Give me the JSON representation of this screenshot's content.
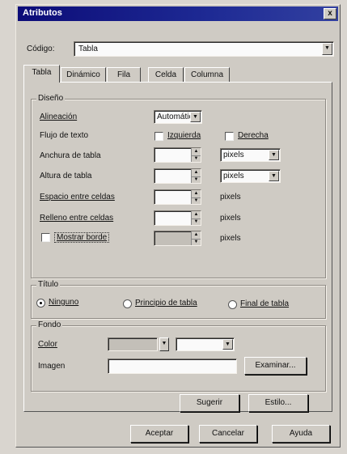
{
  "window": {
    "title": "Atributos",
    "close": "x"
  },
  "codigo": {
    "label": "Código:",
    "value": "Tabla"
  },
  "tabs": [
    {
      "label": "Tabla"
    },
    {
      "label": "Dinámico"
    },
    {
      "label": "Fila"
    },
    {
      "label": "Celda"
    },
    {
      "label": "Columna"
    }
  ],
  "diseno": {
    "title": "Diseño",
    "alineacion": {
      "label": "Alineación",
      "value": "Automátic"
    },
    "flujo": {
      "label": "Flujo de texto",
      "izquierda": "Izquierda",
      "derecha": "Derecha"
    },
    "anchura": {
      "label": "Anchura de tabla",
      "unit": "pixels"
    },
    "altura": {
      "label": "Altura de tabla",
      "unit": "pixels"
    },
    "espacio": {
      "label": "Espacio entre celdas",
      "unit": "pixels"
    },
    "relleno": {
      "label": "Relleno entre celdas",
      "unit": "pixels"
    },
    "mostrar": {
      "label": "Mostrar borde",
      "unit": "pixels"
    }
  },
  "titulo": {
    "title": "Título",
    "options": [
      "Ninguno",
      "Principio de tabla",
      "Final de tabla"
    ],
    "selected": "Ninguno"
  },
  "fondo": {
    "title": "Fondo",
    "color_label": "Color",
    "imagen_label": "Imagen",
    "examinar": "Examinar..."
  },
  "actions": {
    "sugerir": "Sugerir",
    "estilo": "Estilo..."
  },
  "footer": {
    "aceptar": "Aceptar",
    "cancelar": "Cancelar",
    "ayuda": "Ayuda"
  },
  "colors": {
    "title_bar": "#1e2a94",
    "dialog": "#cfcbc4"
  }
}
